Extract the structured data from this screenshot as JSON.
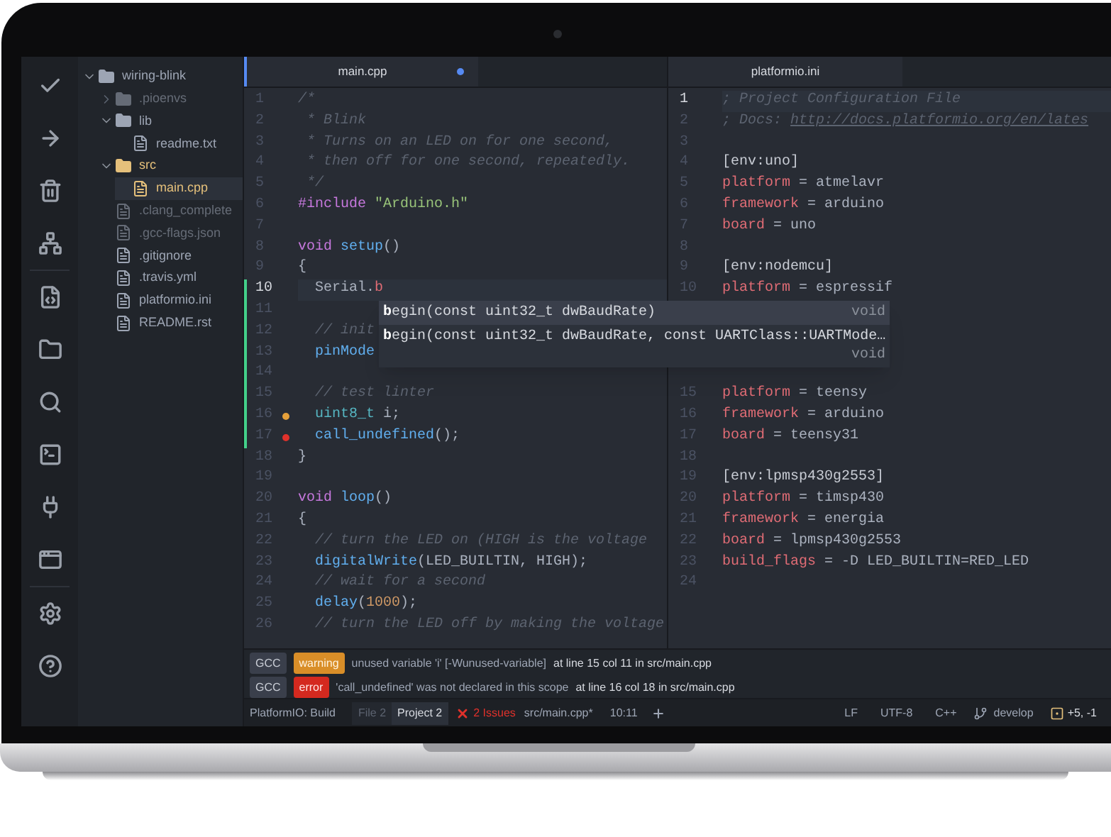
{
  "tree": [
    {
      "name": "wiring-blink",
      "kind": "folder",
      "expanded": true,
      "selected": false,
      "ignored": false,
      "modified": false,
      "children": [
        {
          "name": ".pioenvs",
          "kind": "folder",
          "expanded": false,
          "selected": false,
          "ignored": true,
          "modified": false
        },
        {
          "name": "lib",
          "kind": "folder",
          "expanded": true,
          "selected": false,
          "ignored": false,
          "modified": false,
          "children": [
            {
              "name": "readme.txt",
              "kind": "file",
              "selected": false,
              "ignored": false,
              "modified": false
            }
          ]
        },
        {
          "name": "src",
          "kind": "folder",
          "expanded": true,
          "selected": false,
          "ignored": false,
          "modified": true,
          "children": [
            {
              "name": "main.cpp",
              "kind": "file",
              "selected": true,
              "ignored": false,
              "modified": true
            }
          ]
        },
        {
          "name": ".clang_complete",
          "kind": "file",
          "selected": false,
          "ignored": true,
          "modified": false
        },
        {
          "name": ".gcc-flags.json",
          "kind": "file",
          "selected": false,
          "ignored": true,
          "modified": false
        },
        {
          "name": ".gitignore",
          "kind": "file",
          "selected": false,
          "ignored": false,
          "modified": false
        },
        {
          "name": ".travis.yml",
          "kind": "file",
          "selected": false,
          "ignored": false,
          "modified": false
        },
        {
          "name": "platformio.ini",
          "kind": "file",
          "selected": false,
          "ignored": false,
          "modified": false
        },
        {
          "name": "README.rst",
          "kind": "file",
          "selected": false,
          "ignored": false,
          "modified": false
        }
      ]
    }
  ],
  "editors": [
    {
      "tab": "main.cpp",
      "focused": true,
      "modified": true,
      "lines": [
        {
          "number": "1",
          "cursor": false,
          "modified": false,
          "tokens": [
            {
              "kind": "comment",
              "text": "/*"
            }
          ]
        },
        {
          "number": "2",
          "cursor": false,
          "modified": false,
          "tokens": [
            {
              "kind": "comment",
              "text": " * Blink"
            }
          ]
        },
        {
          "number": "3",
          "cursor": false,
          "modified": false,
          "tokens": [
            {
              "kind": "comment",
              "text": " * Turns on an LED on for one second,"
            }
          ]
        },
        {
          "number": "4",
          "cursor": false,
          "modified": false,
          "tokens": [
            {
              "kind": "comment",
              "text": " * then off for one second, repeatedly."
            }
          ]
        },
        {
          "number": "5",
          "cursor": false,
          "modified": false,
          "tokens": [
            {
              "kind": "comment",
              "text": " */"
            }
          ]
        },
        {
          "number": "6",
          "cursor": false,
          "modified": false,
          "tokens": [
            {
              "kind": "keyword",
              "text": "#include "
            },
            {
              "kind": "string",
              "text": "\"Arduino.h\""
            }
          ]
        },
        {
          "number": "7",
          "cursor": false,
          "modified": false
        },
        {
          "number": "8",
          "cursor": false,
          "modified": false,
          "tokens": [
            {
              "kind": "keyword",
              "text": "void "
            },
            {
              "kind": "function",
              "text": "setup"
            },
            {
              "kind": "plain",
              "text": "()"
            }
          ]
        },
        {
          "number": "9",
          "cursor": false,
          "modified": false,
          "tokens": [
            {
              "kind": "plain",
              "text": "{"
            }
          ]
        },
        {
          "number": "10",
          "cursor": true,
          "modified": true,
          "tokens": [
            {
              "kind": "plain",
              "text": "  Serial."
            },
            {
              "kind": "member",
              "text": "b"
            }
          ]
        },
        {
          "number": "11",
          "cursor": false,
          "modified": true
        },
        {
          "number": "12",
          "cursor": false,
          "modified": true,
          "tokens": [
            {
              "kind": "comment",
              "text": "  // init"
            }
          ]
        },
        {
          "number": "13",
          "cursor": false,
          "modified": true,
          "tokens": [
            {
              "kind": "function",
              "text": "  pinMode"
            }
          ]
        },
        {
          "number": "14",
          "cursor": false,
          "modified": true
        },
        {
          "number": "15",
          "cursor": false,
          "modified": true,
          "tokens": [
            {
              "kind": "comment",
              "text": "  // test linter"
            }
          ]
        },
        {
          "number": "16",
          "cursor": false,
          "modified": true,
          "lint": {
            "kind": "warning"
          },
          "tokens": [
            {
              "kind": "type",
              "text": "  uint8_t"
            },
            {
              "kind": "plain",
              "text": " i;"
            }
          ]
        },
        {
          "number": "17",
          "cursor": false,
          "modified": true,
          "lint": {
            "kind": "error"
          },
          "tokens": [
            {
              "kind": "function",
              "text": "  call_undefined"
            },
            {
              "kind": "plain",
              "text": "();"
            }
          ]
        },
        {
          "number": "18",
          "cursor": false,
          "modified": false,
          "tokens": [
            {
              "kind": "plain",
              "text": "}"
            }
          ]
        },
        {
          "number": "19",
          "cursor": false,
          "modified": false
        },
        {
          "number": "20",
          "cursor": false,
          "modified": false,
          "tokens": [
            {
              "kind": "keyword",
              "text": "void "
            },
            {
              "kind": "function",
              "text": "loop"
            },
            {
              "kind": "plain",
              "text": "()"
            }
          ]
        },
        {
          "number": "21",
          "cursor": false,
          "modified": false,
          "tokens": [
            {
              "kind": "plain",
              "text": "{"
            }
          ]
        },
        {
          "number": "22",
          "cursor": false,
          "modified": false,
          "tokens": [
            {
              "kind": "comment",
              "text": "  // turn the LED on (HIGH is the voltage"
            }
          ]
        },
        {
          "number": "23",
          "cursor": false,
          "modified": false,
          "tokens": [
            {
              "kind": "function",
              "text": "  digitalWrite"
            },
            {
              "kind": "plain",
              "text": "(LED_BUILTIN, HIGH);"
            }
          ]
        },
        {
          "number": "24",
          "cursor": false,
          "modified": false,
          "tokens": [
            {
              "kind": "comment",
              "text": "  // wait for a second"
            }
          ]
        },
        {
          "number": "25",
          "cursor": false,
          "modified": false,
          "tokens": [
            {
              "kind": "function",
              "text": "  delay"
            },
            {
              "kind": "plain",
              "text": "("
            },
            {
              "kind": "number",
              "text": "1000"
            },
            {
              "kind": "plain",
              "text": ");"
            }
          ]
        },
        {
          "number": "26",
          "cursor": false,
          "modified": false,
          "tokens": [
            {
              "kind": "comment",
              "text": "  // turn the LED off by making the voltage"
            }
          ]
        }
      ]
    },
    {
      "tab": "platformio.ini",
      "focused": false,
      "modified": false,
      "lines": [
        {
          "number": "1",
          "cursor": true,
          "modified": false,
          "tokens": [
            {
              "kind": "comment",
              "text": "; Project Configuration File"
            }
          ]
        },
        {
          "number": "2",
          "cursor": false,
          "modified": false,
          "tokens": [
            {
              "kind": "comment",
              "text": "; Docs: "
            },
            {
              "kind": "link",
              "text": "http://docs.platformio.org/en/lates"
            }
          ]
        },
        {
          "number": "3",
          "cursor": false,
          "modified": false
        },
        {
          "number": "4",
          "cursor": false,
          "modified": false,
          "tokens": [
            {
              "kind": "section",
              "text": "[env:uno]"
            }
          ]
        },
        {
          "number": "5",
          "cursor": false,
          "modified": false,
          "tokens": [
            {
              "kind": "key",
              "text": "platform"
            },
            {
              "kind": "plain",
              "text": " = atmelavr"
            }
          ]
        },
        {
          "number": "6",
          "cursor": false,
          "modified": false,
          "tokens": [
            {
              "kind": "key",
              "text": "framework"
            },
            {
              "kind": "plain",
              "text": " = arduino"
            }
          ]
        },
        {
          "number": "7",
          "cursor": false,
          "modified": false,
          "tokens": [
            {
              "kind": "key",
              "text": "board"
            },
            {
              "kind": "plain",
              "text": " = uno"
            }
          ]
        },
        {
          "number": "8",
          "cursor": false,
          "modified": false
        },
        {
          "number": "9",
          "cursor": false,
          "modified": false,
          "tokens": [
            {
              "kind": "section",
              "text": "[env:nodemcu]"
            }
          ]
        },
        {
          "number": "10",
          "cursor": false,
          "modified": false,
          "tokens": [
            {
              "kind": "key",
              "text": "platform"
            },
            {
              "kind": "plain",
              "text": " = espressif"
            }
          ]
        }
      ],
      "lines_below_popup": [
        {
          "number": "15",
          "cursor": false,
          "modified": false,
          "tokens": [
            {
              "kind": "key",
              "text": "platform"
            },
            {
              "kind": "plain",
              "text": " = teensy"
            }
          ]
        },
        {
          "number": "16",
          "cursor": false,
          "modified": false,
          "tokens": [
            {
              "kind": "key",
              "text": "framework"
            },
            {
              "kind": "plain",
              "text": " = arduino"
            }
          ]
        },
        {
          "number": "17",
          "cursor": false,
          "modified": false,
          "tokens": [
            {
              "kind": "key",
              "text": "board"
            },
            {
              "kind": "plain",
              "text": " = teensy31"
            }
          ]
        },
        {
          "number": "18",
          "cursor": false,
          "modified": false
        },
        {
          "number": "19",
          "cursor": false,
          "modified": false,
          "tokens": [
            {
              "kind": "section",
              "text": "[env:lpmsp430g2553]"
            }
          ]
        },
        {
          "number": "20",
          "cursor": false,
          "modified": false,
          "tokens": [
            {
              "kind": "key",
              "text": "platform"
            },
            {
              "kind": "plain",
              "text": " = timsp430"
            }
          ]
        },
        {
          "number": "21",
          "cursor": false,
          "modified": false,
          "tokens": [
            {
              "kind": "key",
              "text": "framework"
            },
            {
              "kind": "plain",
              "text": " = energia"
            }
          ]
        },
        {
          "number": "22",
          "cursor": false,
          "modified": false,
          "tokens": [
            {
              "kind": "key",
              "text": "board"
            },
            {
              "kind": "plain",
              "text": " = lpmsp430g2553"
            }
          ]
        },
        {
          "number": "23",
          "cursor": false,
          "modified": false,
          "tokens": [
            {
              "kind": "key",
              "text": "build_flags"
            },
            {
              "kind": "plain",
              "text": " = -D LED_BUILTIN=RED_LED"
            }
          ]
        },
        {
          "number": "24",
          "cursor": false,
          "modified": false
        }
      ]
    }
  ],
  "autocomplete": [
    {
      "match": "b",
      "rest": "egin(const uint32_t dwBaudRate)",
      "type": "void",
      "selected": true
    },
    {
      "match": "b",
      "rest": "egin(const uint32_t dwBaudRate, const UARTClass::UARTMode…",
      "type": "void",
      "selected": false
    }
  ],
  "messages": [
    {
      "source": "GCC",
      "kind": "warning",
      "label": "warning",
      "text": "unused variable 'i' [-Wunused-variable]",
      "location": "at line 15 col 11 in src/main.cpp"
    },
    {
      "source": "GCC",
      "kind": "error",
      "label": "error",
      "text": "'call_undefined' was not declared in this scope",
      "location": "at line 16 col 18 in src/main.cpp"
    }
  ],
  "status_bar": {
    "build": "PlatformIO: Build",
    "scopes": [
      {
        "label": "File 2",
        "selected": false
      },
      {
        "label": "Project 2",
        "selected": true
      }
    ],
    "issues": "2 Issues",
    "file": "src/main.cpp*",
    "cursor": "10:11",
    "line_ending": "LF",
    "encoding": "UTF-8",
    "grammar": "C++",
    "branch": "develop",
    "diff": "+5, -1"
  }
}
